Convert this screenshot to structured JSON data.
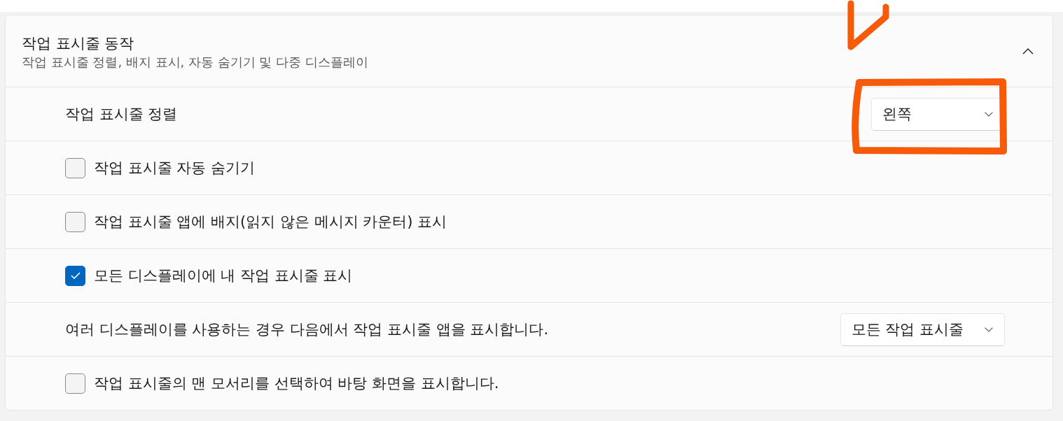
{
  "section": {
    "title": "작업 표시줄 동작",
    "subtitle": "작업 표시줄 정렬, 배지 표시, 자동 숨기기 및 다중 디스플레이",
    "expanded": true
  },
  "settings": [
    {
      "kind": "dropdown",
      "label": "작업 표시줄 정렬",
      "value": "왼쪽"
    },
    {
      "kind": "checkbox",
      "label": "작업 표시줄 자동 숨기기",
      "checked": false
    },
    {
      "kind": "checkbox",
      "label": "작업 표시줄 앱에 배지(읽지 않은 메시지 카운터) 표시",
      "checked": false
    },
    {
      "kind": "checkbox",
      "label": "모든 디스플레이에 내 작업 표시줄 표시",
      "checked": true
    },
    {
      "kind": "dropdown",
      "label": "여러 디스플레이를 사용하는 경우 다음에서 작업 표시줄 앱을 표시합니다.",
      "value": "모든 작업 표시줄"
    },
    {
      "kind": "checkbox",
      "label": "작업 표시줄의 맨 모서리를 선택하여 바탕 화면을 표시합니다.",
      "checked": false
    }
  ],
  "annotations": [
    {
      "kind": "check-mark"
    },
    {
      "kind": "frame"
    }
  ]
}
